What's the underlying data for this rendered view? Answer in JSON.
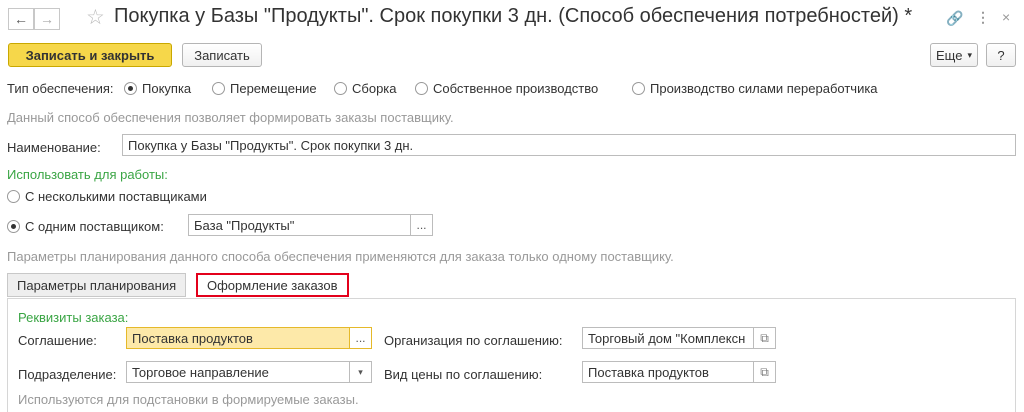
{
  "header": {
    "title": "Покупка у Базы \"Продукты\". Срок покупки 3 дн. (Способ обеспечения потребностей) *",
    "back_icon": "arrow-left-icon",
    "forward_icon": "arrow-right-icon",
    "star_icon": "star-outline-icon",
    "link_icon": "link-icon",
    "more_icon": "more-vertical-icon",
    "close_icon": "close-icon"
  },
  "toolbar": {
    "save_close_label": "Записать и закрыть",
    "save_label": "Записать",
    "more_label": "Еще",
    "help_label": "?"
  },
  "supply_type": {
    "label": "Тип обеспечения:",
    "options": [
      "Покупка",
      "Перемещение",
      "Сборка",
      "Собственное производство",
      "Производство силами переработчика"
    ],
    "selected": "Покупка",
    "hint": "Данный способ обеспечения позволяет формировать заказы поставщику."
  },
  "name_field": {
    "label": "Наименование:",
    "value": "Покупка у Базы \"Продукты\". Срок покупки 3 дн."
  },
  "usage": {
    "heading": "Использовать для работы:",
    "option_many": "С несколькими поставщиками",
    "option_one": "С одним поставщиком:",
    "supplier_value": "База \"Продукты\"",
    "selected": "С одним поставщиком:",
    "hint": "Параметры планирования данного способа обеспечения применяются для заказа только одному поставщику."
  },
  "tabs": [
    {
      "label": "Параметры планирования",
      "active": false
    },
    {
      "label": "Оформление заказов",
      "active": true
    }
  ],
  "order_details": {
    "heading": "Реквизиты заказа:",
    "agreement_label": "Соглашение:",
    "agreement_value": "Поставка продуктов",
    "org_label": "Организация по соглашению:",
    "org_value": "Торговый дом \"Комплексн",
    "division_label": "Подразделение:",
    "division_value": "Торговое направление",
    "price_label": "Вид цены по соглашению:",
    "price_value": "Поставка продуктов",
    "hint": "Используются для подстановки в формируемые заказы."
  },
  "colors": {
    "accent_yellow": "#f6d74a",
    "hint_green": "#3aa544",
    "active_tab_border": "#e3001b",
    "active_field": "#fde9a9"
  }
}
